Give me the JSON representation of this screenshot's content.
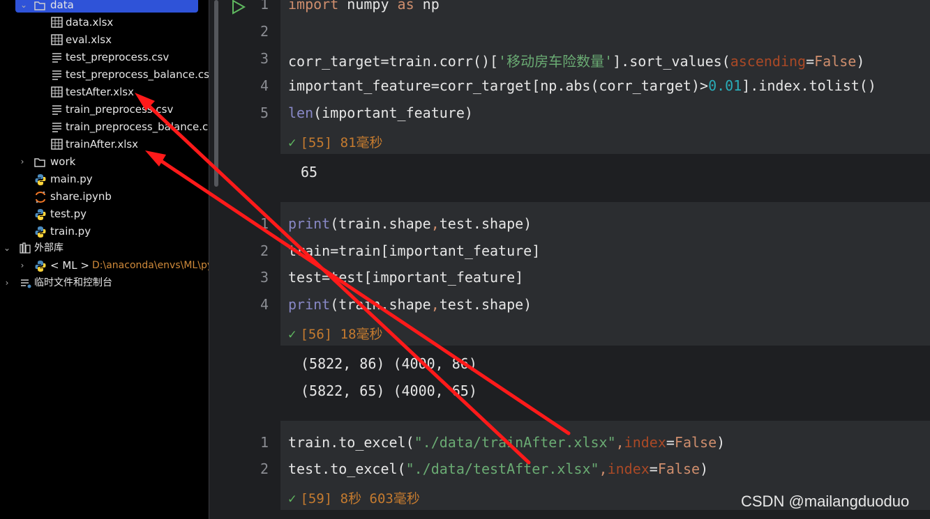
{
  "sidebar": {
    "folder_data": "data",
    "files": [
      "data.xlsx",
      "eval.xlsx",
      "test_preprocess.csv",
      "test_preprocess_balance.csv",
      "testAfter.xlsx",
      "train_preprocess.csv",
      "train_preprocess_balance.csv",
      "trainAfter.xlsx"
    ],
    "folder_work": "work",
    "root_files": [
      "main.py",
      "share.ipynb",
      "test.py",
      "train.py"
    ],
    "external_libs": "外部库",
    "env_label": "< ML >",
    "env_path": "D:\\anaconda\\envs\\ML\\python.exe",
    "scratches": "临时文件和控制台"
  },
  "cells": [
    {
      "lines": [
        "1",
        "2",
        "3",
        "4",
        "5"
      ],
      "l1_kw1": "import",
      "l1_mid": " numpy ",
      "l1_kw2": "as",
      "l1_end": " np",
      "l3_a": "corr_target=train.corr()[",
      "l3_str": "'移动房车险数量'",
      "l3_b": "].sort_values(",
      "l3_prm": "ascending",
      "l3_eq": "=",
      "l3_kw": "False",
      "l3_c": ")",
      "l4_a": "important_feature=corr_target[np.abs(corr_target)>",
      "l4_num": "0.01",
      "l4_b": "].index.tolist()",
      "l5_bi": "len",
      "l5_b": "(important_feature)",
      "status": "[55] 81毫秒",
      "output": "65"
    },
    {
      "lines": [
        "1",
        "2",
        "3",
        "4"
      ],
      "l1_bi": "print",
      "l1_a": "(train.shape",
      "l1_comma": ",",
      "l1_b": "test.shape)",
      "l2": "train=train[important_feature]",
      "l3": "test=test[important_feature]",
      "l4_bi": "print",
      "l4_a": "(train.shape",
      "l4_comma": ",",
      "l4_b": "test.shape)",
      "status": "[56] 18毫秒",
      "output1": "(5822, 86) (4000, 86)",
      "output2": "(5822, 65) (4000, 65)"
    },
    {
      "lines": [
        "1",
        "2"
      ],
      "l1_a": "train.to_excel(",
      "l1_str": "\"./data/trainAfter.xlsx\"",
      "l1_comma": ",",
      "l1_prm": "index",
      "l1_eq": "=",
      "l1_kw": "False",
      "l1_end": ")",
      "l2_a": "test.to_excel(",
      "l2_str": "\"./data/testAfter.xlsx\"",
      "l2_comma": ",",
      "l2_prm": "index",
      "l2_eq": "=",
      "l2_kw": "False",
      "l2_end": ")",
      "status": "[59] 8秒 603毫秒"
    }
  ],
  "watermark": "CSDN @mailangduoduo",
  "colors": {
    "selection": "#2f53d8",
    "arrow": "#ff1a1a"
  },
  "icons": [
    "chevron-down-icon",
    "folder-icon",
    "table-icon",
    "text-file-icon",
    "python-icon",
    "notebook-icon",
    "library-icon",
    "chevron-right-icon",
    "run-icon",
    "check-icon",
    "scratch-icon"
  ]
}
